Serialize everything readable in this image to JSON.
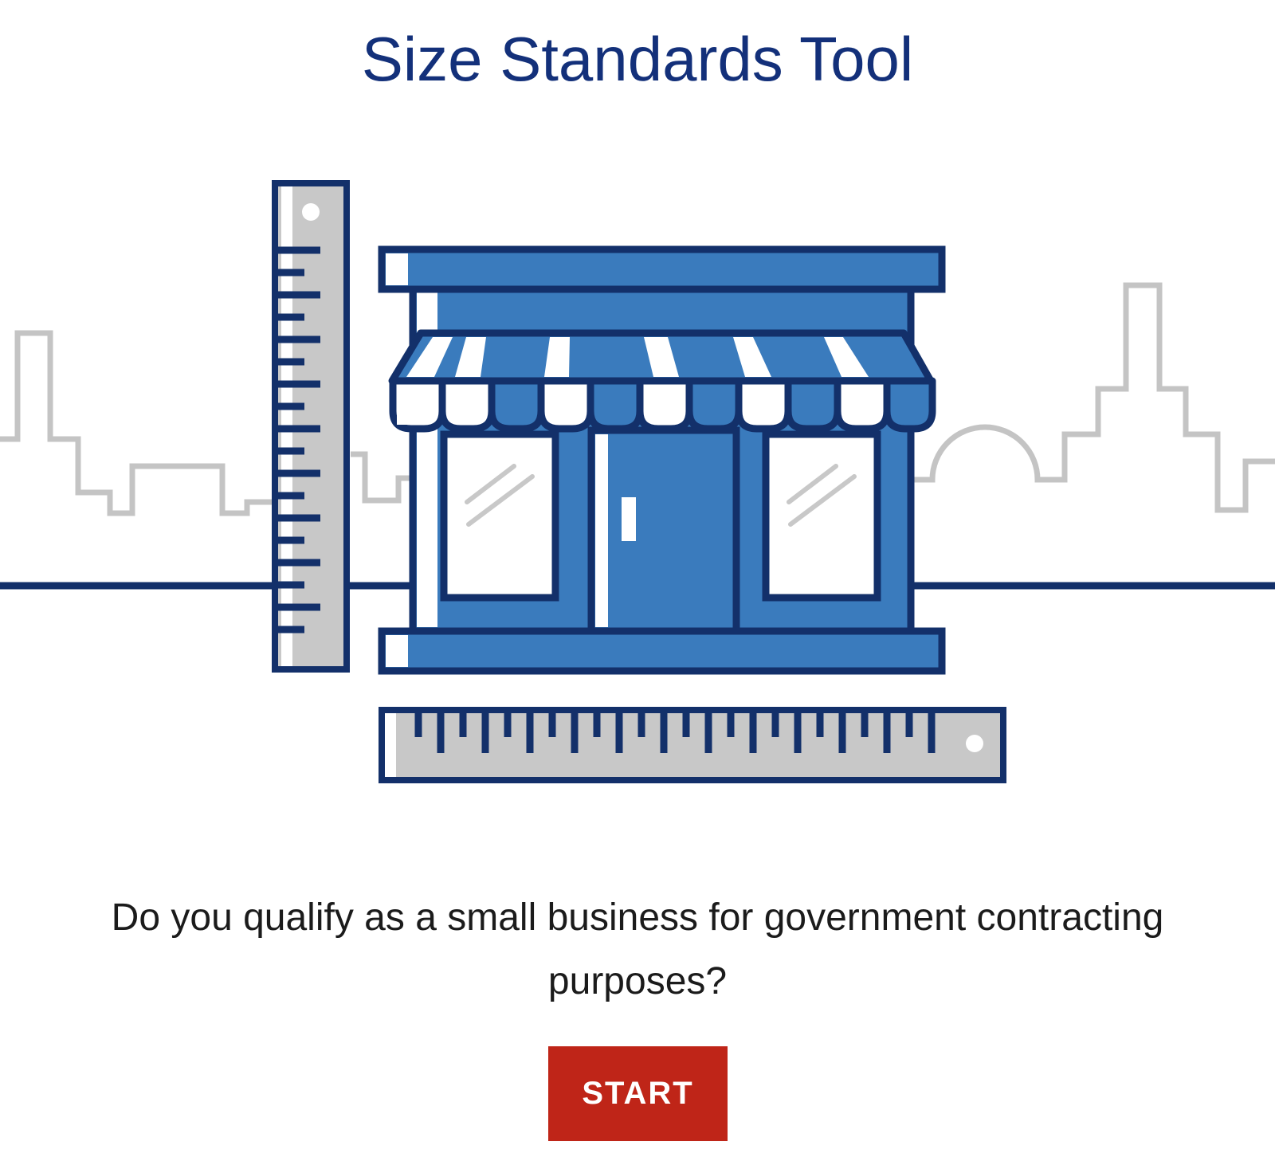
{
  "page": {
    "title": "Size Standards Tool",
    "question": "Do you qualify as a small business for government contracting purposes?",
    "start_button_label": "START"
  },
  "illustration": {
    "icons": [
      "storefront-icon",
      "vertical-ruler-icon",
      "horizontal-ruler-icon",
      "city-skyline-icon"
    ]
  },
  "colors": {
    "title": "#13307a",
    "navy": "#13306a",
    "store_blue": "#3a7bbd",
    "ruler_gray": "#c8c8c8",
    "skyline_gray": "#c4c4c4",
    "button_red": "#bf2518",
    "text": "#1b1b1b"
  }
}
